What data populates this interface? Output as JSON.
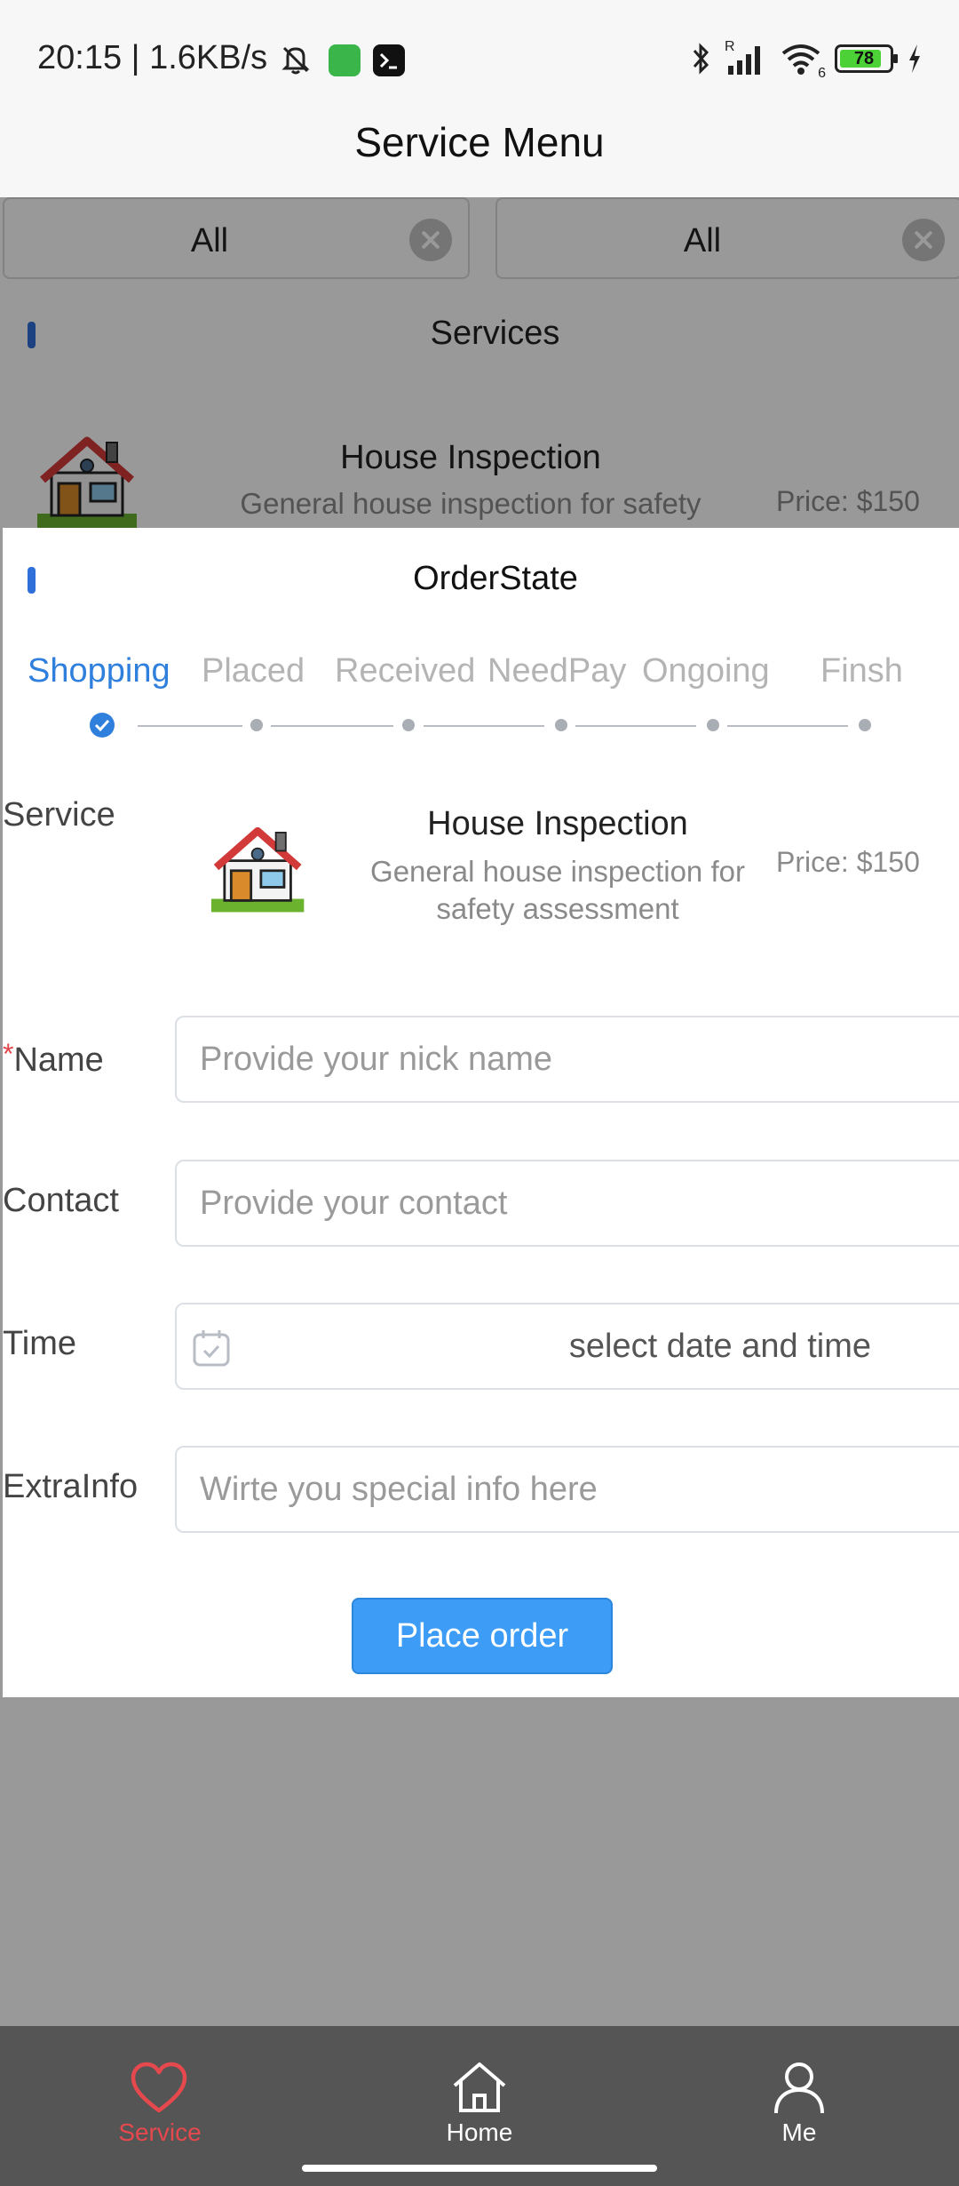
{
  "status_bar": {
    "time_speed": "20:15 | 1.6KB/s",
    "signal_label": "R",
    "wifi_label": "6",
    "battery": "78"
  },
  "header": {
    "title": "Service Menu"
  },
  "filters": [
    {
      "value": "All"
    },
    {
      "value": "All"
    }
  ],
  "services_section": {
    "title": "Services",
    "item": {
      "title": "House Inspection",
      "description": "General house inspection for safety assessment",
      "price": "Price: $150"
    }
  },
  "order_popup": {
    "title": "OrderState",
    "steps": [
      "Shopping",
      "Placed",
      "Received",
      "NeedPay",
      "Ongoing",
      "Finsh"
    ],
    "active_step": 0,
    "service": {
      "label": "Service",
      "title": "House Inspection",
      "description": "General house inspection for safety assessment",
      "price": "Price: $150"
    },
    "form": {
      "name": {
        "required_mark": "*",
        "label": "Name",
        "placeholder": "Provide your nick name",
        "value": ""
      },
      "contact": {
        "label": "Contact",
        "placeholder": "Provide your contact",
        "value": ""
      },
      "time": {
        "label": "Time",
        "text": "select date and time"
      },
      "extra": {
        "label": "ExtraInfo",
        "placeholder": "Wirte you special info here",
        "value": ""
      }
    },
    "submit_label": "Place order"
  },
  "tab_bar": {
    "items": [
      {
        "label": "Service",
        "icon": "heart-icon",
        "active": true
      },
      {
        "label": "Home",
        "icon": "home-icon",
        "active": false
      },
      {
        "label": "Me",
        "icon": "user-icon",
        "active": false
      }
    ],
    "active_color": "#e5484d"
  },
  "colors": {
    "accent": "#2f7fdd",
    "button": "#3d9cf5",
    "required": "#e3454b"
  }
}
